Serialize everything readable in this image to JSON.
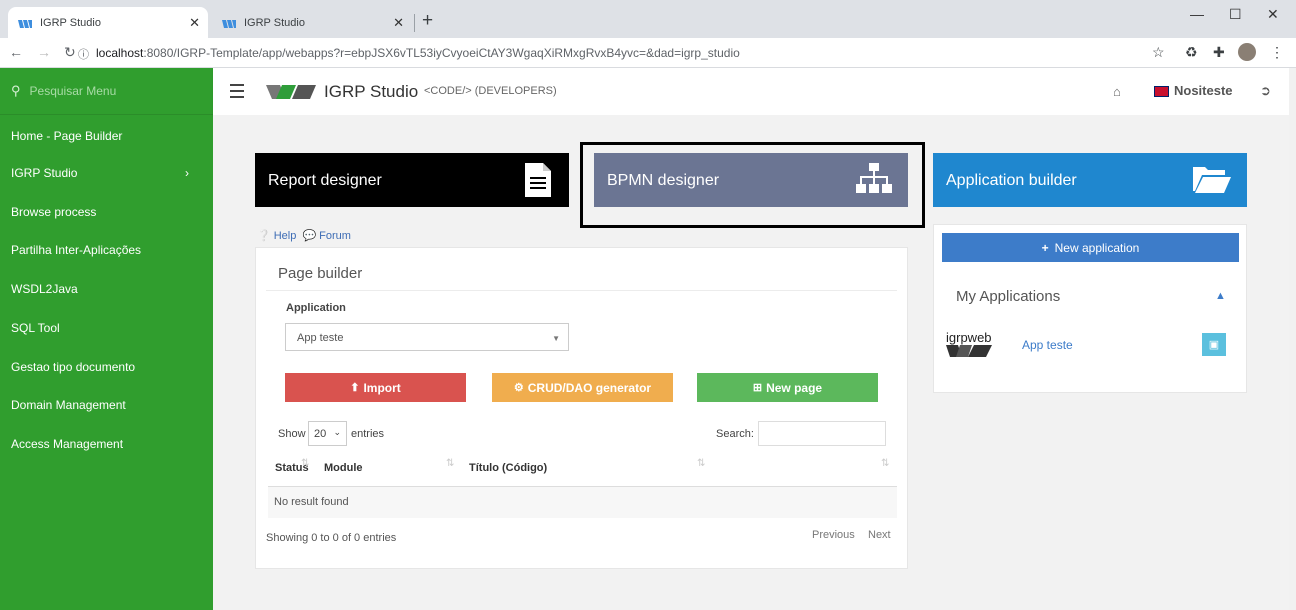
{
  "browser": {
    "tabs": [
      {
        "title": "IGRP Studio",
        "close": "✕"
      },
      {
        "title": "IGRP Studio",
        "close": "✕"
      }
    ],
    "new_tab": "+",
    "window_controls": [
      "—",
      "☐",
      "✕"
    ],
    "url_host": "localhost",
    "url_rest": ":8080/IGRP-Template/app/webapps?r=ebpJSX6vTL53iyCvyoeiCtAY3WgaqXiRMxgRvxB4yvc=&dad=igrp_studio",
    "icons": [
      "star-icon",
      "recycle-icon",
      "puzzle-icon",
      "profile-avatar",
      "kebab-menu-icon"
    ]
  },
  "sidebar": {
    "search_placeholder": "Pesquisar Menu",
    "items": [
      {
        "label": "Home - Page Builder"
      },
      {
        "label": "IGRP Studio",
        "chevron": "›"
      },
      {
        "label": "Browse process"
      },
      {
        "label": "Partilha Inter-Aplicações"
      },
      {
        "label": "WSDL2Java"
      },
      {
        "label": "SQL Tool"
      },
      {
        "label": "Gestao tipo documento"
      },
      {
        "label": "Domain Management"
      },
      {
        "label": "Access Management"
      }
    ]
  },
  "header": {
    "brand": "IGRP Studio",
    "subtitle": "<CODE/> (DEVELOPERS)",
    "user": "Nositeste"
  },
  "tiles": [
    {
      "label": "Report designer",
      "color": "#000000",
      "icon": "document-icon"
    },
    {
      "label": "BPMN designer",
      "color": "#6b7593",
      "icon": "sitemap-icon"
    },
    {
      "label": "Application builder",
      "color": "#1f87cf",
      "icon": "folder-open-icon"
    }
  ],
  "links": {
    "help": "Help",
    "forum": "Forum"
  },
  "page_builder": {
    "title": "Page builder",
    "application_label": "Application",
    "application_value": "App teste",
    "buttons": {
      "import": "Import",
      "crud": "CRUD/DAO generator",
      "new_page": "New page"
    },
    "show_label": "Show",
    "page_length": "20",
    "entries_label": "entries",
    "search_label": "Search:",
    "columns": [
      "Status",
      "Module",
      "Título (Código)"
    ],
    "empty_message": "No result found",
    "info": "Showing 0 to 0 of 0 entries",
    "previous": "Previous",
    "next": "Next"
  },
  "app_panel": {
    "new_application": "New application",
    "my_applications": "My Applications",
    "logo_text": "igrpweb",
    "app_name": "App teste"
  },
  "colors": {
    "sidebar": "#309e2e",
    "import": "#d9534f",
    "crud": "#f0ad4e",
    "new_page": "#5cb85c",
    "primary": "#3d7cc9"
  }
}
